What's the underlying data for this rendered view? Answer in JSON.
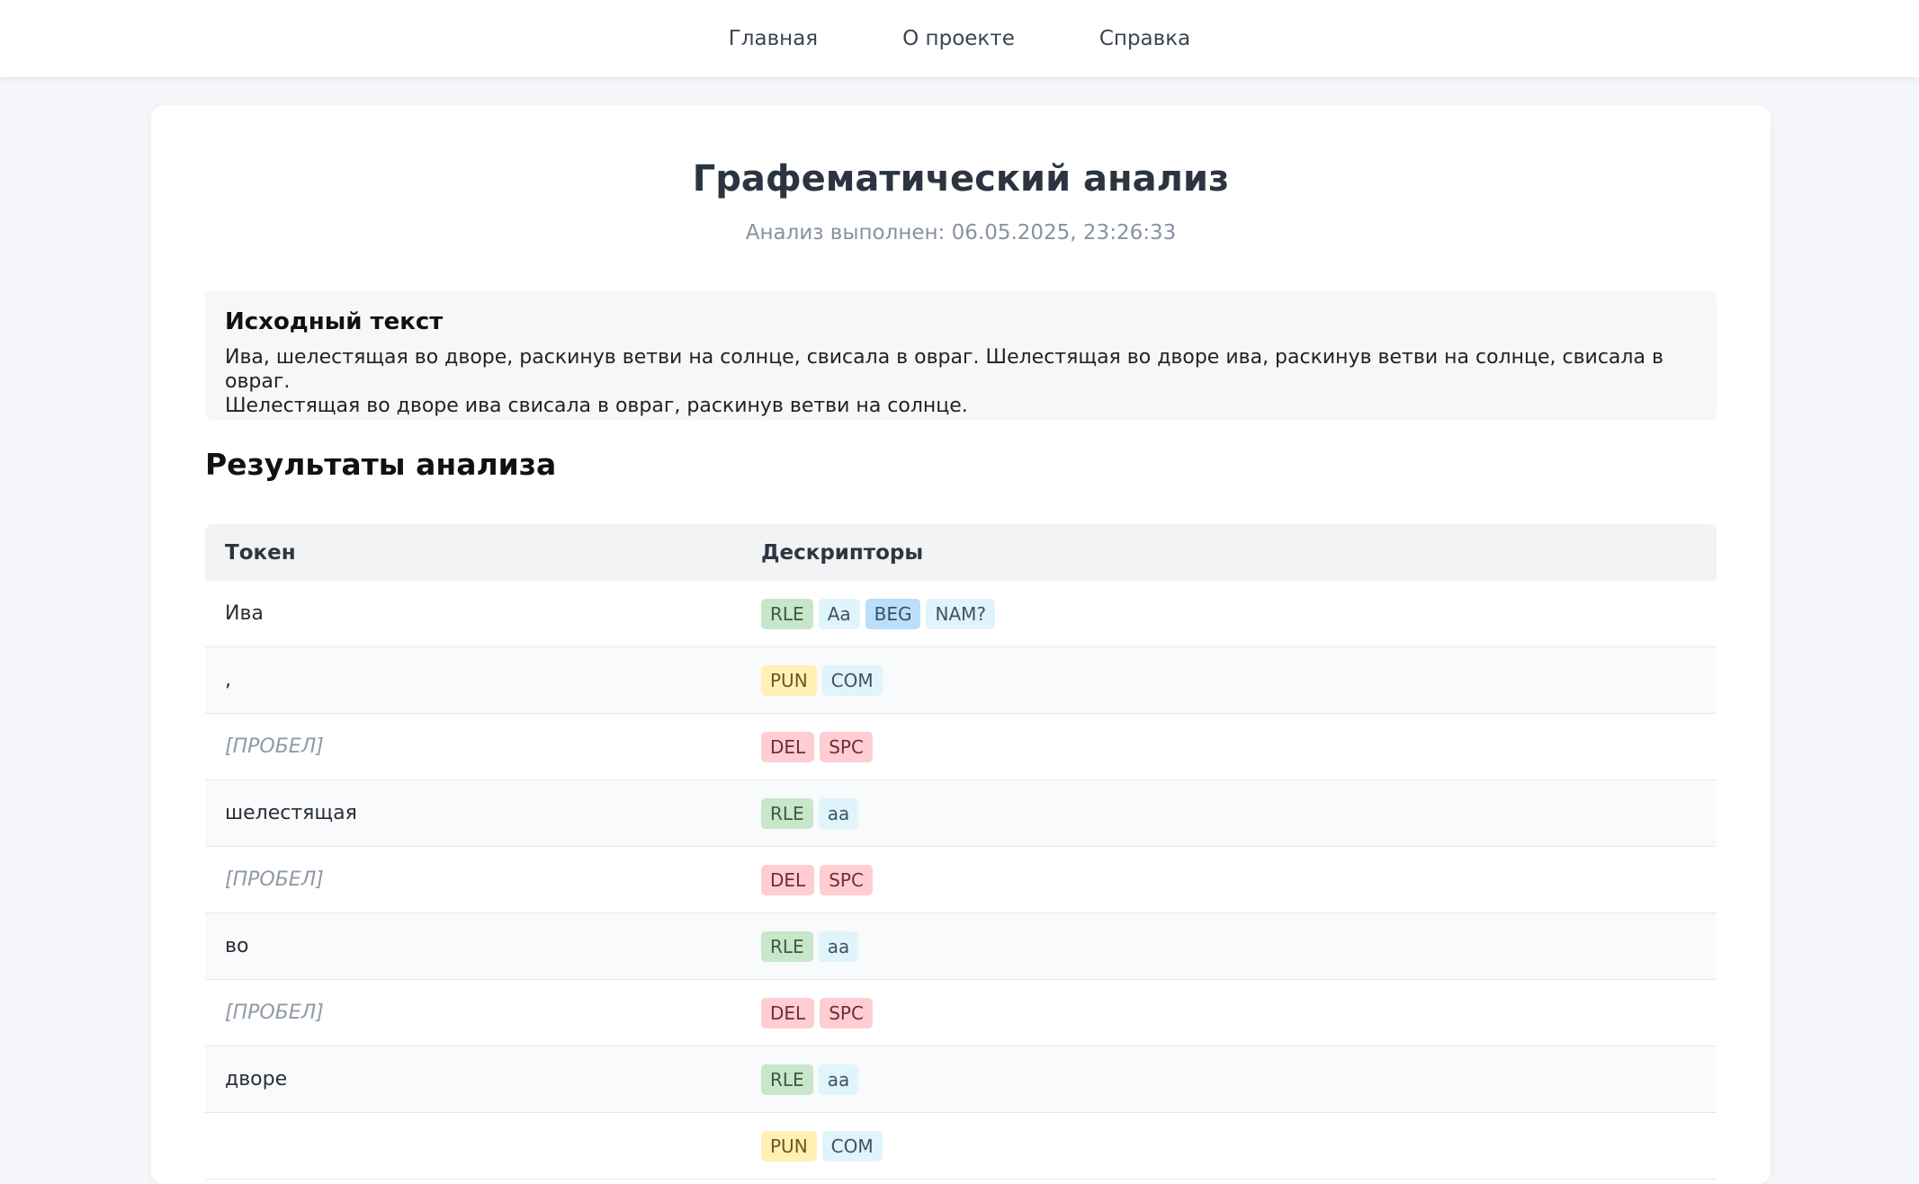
{
  "nav": {
    "items": [
      "Главная",
      "О проекте",
      "Справка"
    ]
  },
  "page": {
    "title": "Графематический анализ",
    "subtitle": "Анализ выполнен: 06.05.2025, 23:26:33"
  },
  "source": {
    "heading": "Исходный текст",
    "text_line1": "Ива, шелестящая во дворе, раскинув ветви на солнце, свисала в овраг. Шелестящая во дворе ива, раскинув ветви на солнце, свисала в овраг.",
    "text_line2": "Шелестящая во дворе ива свисала в овраг, раскинув ветви на солнце."
  },
  "results": {
    "heading": "Результаты анализа",
    "columns": [
      "Токен",
      "Дескрипторы"
    ],
    "rows": [
      {
        "token": "Ива",
        "tags": [
          "RLE",
          "Aa",
          "BEG",
          "NAM?"
        ]
      },
      {
        "token": ",",
        "tags": [
          "PUN",
          "COM"
        ]
      },
      {
        "token": "[ПРОБЕЛ]",
        "tags": [
          "DEL",
          "SPC"
        ]
      },
      {
        "token": "шелестящая",
        "tags": [
          "RLE",
          "aa"
        ]
      },
      {
        "token": "[ПРОБЕЛ]",
        "tags": [
          "DEL",
          "SPC"
        ]
      },
      {
        "token": "во",
        "tags": [
          "RLE",
          "aa"
        ]
      },
      {
        "token": "[ПРОБЕЛ]",
        "tags": [
          "DEL",
          "SPC"
        ]
      },
      {
        "token": "дворе",
        "tags": [
          "RLE",
          "aa"
        ]
      },
      {
        "token": "",
        "tags": [
          "PUN",
          "COM"
        ]
      }
    ]
  },
  "tag_colors": {
    "RLE": "#c8e6c9",
    "Aa": "#e0f4fb",
    "aa": "#e0f4fb",
    "BEG": "#bbdefb",
    "NAM?": "#e0f4fb",
    "PUN": "#fff0b3",
    "COM": "#e0f4fb",
    "DEL": "#ffcdd2",
    "SPC": "#ffcdd2"
  }
}
